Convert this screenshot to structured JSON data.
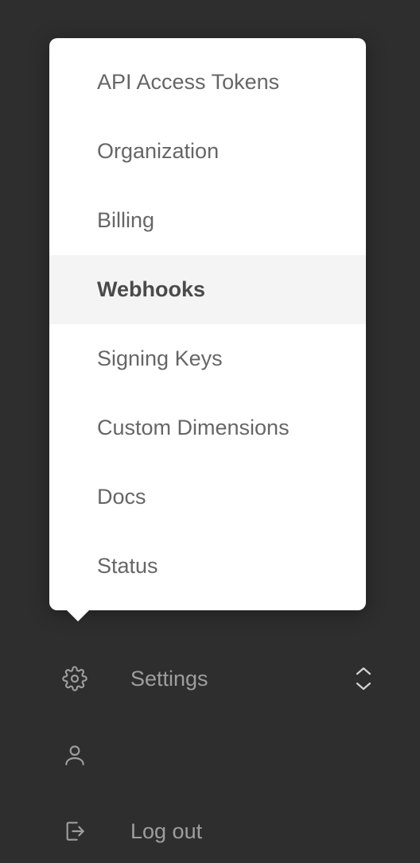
{
  "menu": {
    "items": [
      {
        "label": "API Access Tokens",
        "active": false
      },
      {
        "label": "Organization",
        "active": false
      },
      {
        "label": "Billing",
        "active": false
      },
      {
        "label": "Webhooks",
        "active": true
      },
      {
        "label": "Signing Keys",
        "active": false
      },
      {
        "label": "Custom Dimensions",
        "active": false
      },
      {
        "label": "Docs",
        "active": false
      },
      {
        "label": "Status",
        "active": false
      }
    ]
  },
  "nav": {
    "settings_label": "Settings",
    "logout_label": "Log out"
  }
}
